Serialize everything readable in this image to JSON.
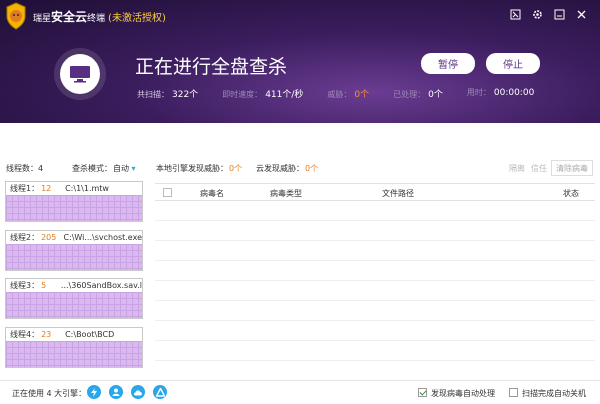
{
  "brand": {
    "name_prefix": "瑞星",
    "name_main": "安全云",
    "name_suffix": "终端",
    "activation": "(未激活授权)"
  },
  "scan": {
    "title": "正在进行全盘查杀",
    "pause_label": "暂停",
    "stop_label": "停止"
  },
  "stats": {
    "scanned_label": "共扫描：",
    "scanned_value": "322个",
    "speed_label": "即时速度：",
    "speed_value": "411个/秒",
    "threat_label": "威胁：",
    "threat_value": "0个",
    "handled_label": "已处理：",
    "handled_value": "0个",
    "time_label": "用时：",
    "time_value": "00:00:00"
  },
  "toolbar": {
    "threads": "线程数：4",
    "mode_label": "查杀模式：",
    "mode_value": "自动",
    "local_threat_label": "本地引擎发现威胁：",
    "local_threat_value": "0个",
    "cloud_threat_label": "云发现威胁：",
    "cloud_threat_value": "0个",
    "isolate": "隔离",
    "trust": "信任",
    "clear": "清除病毒"
  },
  "threads": [
    {
      "label": "线程1：",
      "count": "12",
      "path": "C:\\1\\1.mtw"
    },
    {
      "label": "线程2：",
      "count": "205",
      "path": "C:\\Wi...\\svchost.exe"
    },
    {
      "label": "线程3：",
      "count": "5",
      "path": "...\\360SandBox.sav.l"
    },
    {
      "label": "线程4：",
      "count": "23",
      "path": "C:\\Boot\\BCD"
    }
  ],
  "table": {
    "columns": [
      "病毒名",
      "病毒类型",
      "文件路径",
      "状态"
    ]
  },
  "bottom": {
    "engines": "正在使用 4 大引擎：",
    "auto_handle": "发现病毒自动处理",
    "auto_shutdown": "扫描完成自动关机"
  },
  "colors": {
    "accent": "#5a2f82",
    "warning": "#e07b1f",
    "header_bg": "#3b1d5e"
  }
}
